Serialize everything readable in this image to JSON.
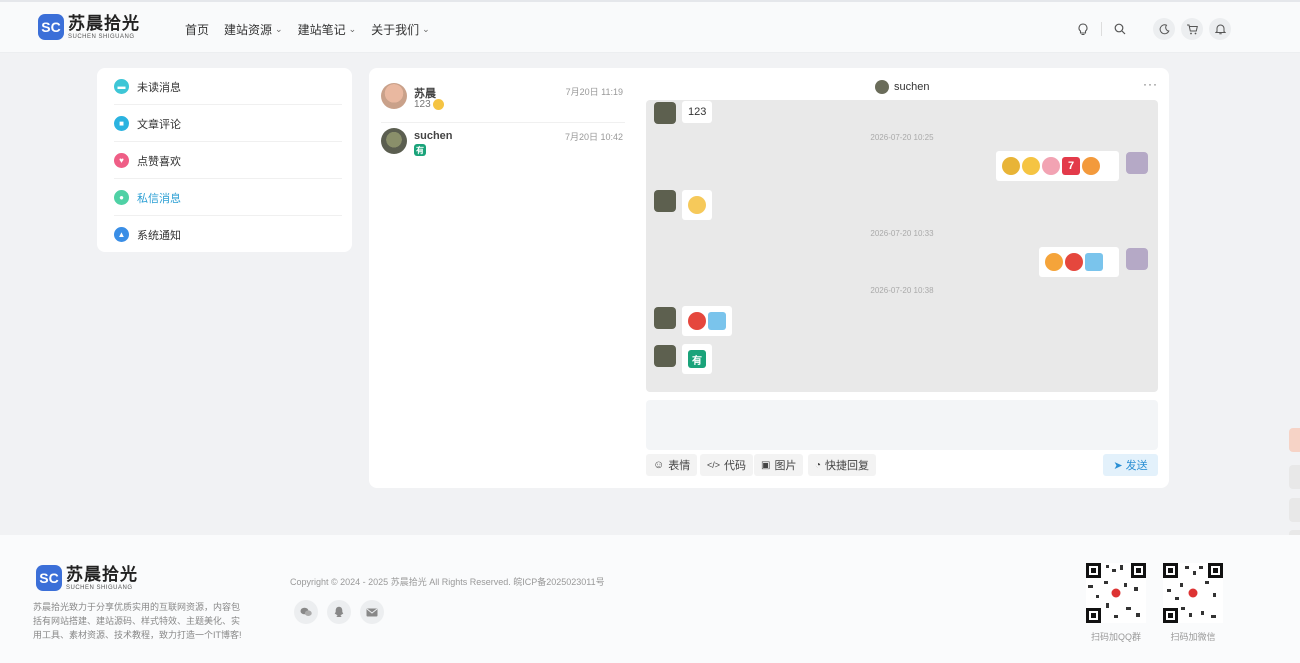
{
  "header": {
    "logo_cn": "苏晨拾光",
    "logo_en": "SUCHEN SHIGUANG",
    "nav": [
      {
        "label": "首页",
        "has_menu": false
      },
      {
        "label": "建站资源",
        "has_menu": true
      },
      {
        "label": "建站笔记",
        "has_menu": true
      },
      {
        "label": "关于我们",
        "has_menu": true
      }
    ],
    "icons": [
      "lightbulb-icon",
      "search-icon",
      "moon-icon",
      "cart-icon",
      "bell-icon"
    ]
  },
  "sidebar": {
    "items": [
      {
        "label": "未读消息",
        "icon": "chat-icon",
        "color": "#3ec6d6",
        "active": false
      },
      {
        "label": "文章评论",
        "icon": "comment-icon",
        "color": "#2bb3e0",
        "active": false
      },
      {
        "label": "点赞喜欢",
        "icon": "heart-icon",
        "color": "#ef5e86",
        "active": false
      },
      {
        "label": "私信消息",
        "icon": "message-icon",
        "color": "#4fd1a5",
        "active": true
      },
      {
        "label": "系统通知",
        "icon": "drop-icon",
        "color": "#3a8ee6",
        "active": false
      }
    ]
  },
  "conversations": [
    {
      "name": "苏晨",
      "last_message": "123",
      "time": "7月20日 11:19"
    },
    {
      "name": "suchen",
      "last_message": "有",
      "time": "7月20日 10:42"
    }
  ],
  "chat": {
    "title": "suchen",
    "messages": [
      {
        "side": "left",
        "text": "123"
      },
      {
        "timestamp": "2026-07-20 10:25"
      },
      {
        "side": "right",
        "emoji": [
          "grin-face",
          "cheer-face",
          "pig-face",
          "seven-emoji",
          "angry-face"
        ]
      },
      {
        "side": "left",
        "emoji": [
          "shocked-face"
        ]
      },
      {
        "timestamp": "2026-07-20 10:33"
      },
      {
        "side": "right",
        "emoji": [
          "scream-face",
          "rage-face",
          "airplane-emoji"
        ]
      },
      {
        "timestamp": "2026-07-20 10:38"
      },
      {
        "side": "left",
        "emoji": [
          "rage-face",
          "airplane-emoji"
        ]
      },
      {
        "side": "left",
        "badge": "有"
      }
    ],
    "toolbar": {
      "emoji_label": "表情",
      "code_label": "代码",
      "image_label": "图片",
      "quick_reply_label": "快捷回复",
      "send_label": "发送"
    }
  },
  "footer": {
    "logo_cn": "苏晨拾光",
    "logo_en": "SUCHEN SHIGUANG",
    "description": "苏晨拾光致力于分享优质实用的互联网资源，内容包括有网站搭建、建站源码、样式特效、主题美化、实用工具、素材资源、技术教程，致力打造一个IT博客!",
    "copyright": "Copyright © 2024 - 2025 苏晨拾光 All Rights Reserved. 皖ICP备2025023011号",
    "qr_labels": [
      "扫码加QQ群",
      "扫码加微信"
    ]
  },
  "colors": {
    "accent": "#2b9fd4",
    "brand": "#3b6fd8",
    "chat_bg": "#e9e9e9"
  }
}
